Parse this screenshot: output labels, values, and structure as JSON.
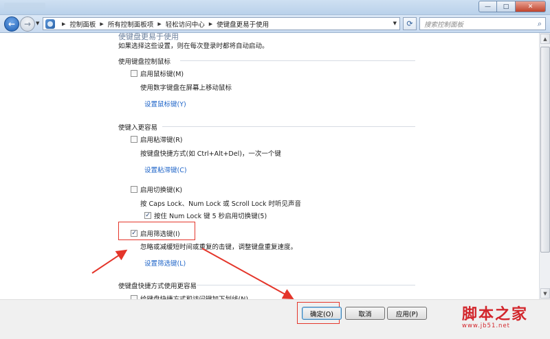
{
  "window": {
    "minimize": "—",
    "maximize": "□",
    "close": "✕"
  },
  "address": {
    "breadcrumbs": [
      "控制面板",
      "所有控制面板项",
      "轻松访问中心",
      "使键盘更易于使用"
    ],
    "search_placeholder": "搜索控制面板"
  },
  "page": {
    "title": "使键盘更易于使用",
    "intro": "如果选择这些设置，则在每次登录时都将自动启动。"
  },
  "sections": {
    "mouse": {
      "heading": "使用键盘控制鼠标",
      "mousekeys_label": "启用鼠标键(M)",
      "mousekeys_checked": false,
      "mousekeys_desc": "使用数字键盘在屏幕上移动鼠标",
      "mousekeys_link": "设置鼠标键(Y)"
    },
    "typing": {
      "heading": "使键入更容易",
      "sticky_label": "启用粘滞键(R)",
      "sticky_checked": false,
      "sticky_desc": "按键盘快捷方式(如 Ctrl+Alt+Del)，一次一个键",
      "sticky_link": "设置粘滞键(C)",
      "toggle_label": "启用切换键(K)",
      "toggle_checked": false,
      "toggle_desc": "按 Caps Lock、Num Lock 或 Scroll Lock 时听见声音",
      "toggle_sub_label": "按住 Num Lock 键 5 秒启用切换键(5)",
      "toggle_sub_checked": true,
      "filter_label": "启用筛选键(I)",
      "filter_checked": true,
      "filter_desc": "忽略或减缓短时间或重复的击键，调整键盘重复速度。",
      "filter_link": "设置筛选键(L)"
    },
    "shortcuts": {
      "heading": "使键盘快捷方式使用更容易",
      "underline_label": "给键盘快捷方式和访问键加下划线(N)",
      "underline_checked": false
    }
  },
  "buttons": {
    "ok": "确定(O)",
    "cancel": "取消",
    "apply": "应用(P)"
  },
  "watermark": {
    "title": "脚本之家",
    "url": "www.jb51.net"
  },
  "colors": {
    "annotation": "#e4352a",
    "link": "#1e64c8",
    "watermark": "#d2252b"
  }
}
